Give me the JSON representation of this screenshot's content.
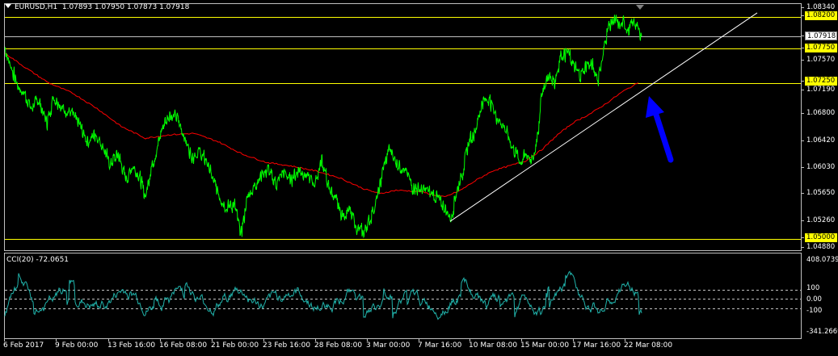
{
  "header": {
    "symbol": "EURUSD,H1",
    "ohlc": "1.07893 1.07950 1.07873 1.07918"
  },
  "indicator": {
    "label": "CCI(20) -72.0651"
  },
  "price_scale": {
    "labels": [
      {
        "text": "1.08340",
        "style": "plain"
      },
      {
        "text": "1.08200",
        "style": "highlight"
      },
      {
        "text": "1.07918",
        "style": "current"
      },
      {
        "text": "1.07750",
        "style": "highlight"
      },
      {
        "text": "1.07570",
        "style": "plain"
      },
      {
        "text": "1.07250",
        "style": "highlight"
      },
      {
        "text": "1.07190",
        "style": "plain"
      },
      {
        "text": "1.06800",
        "style": "plain"
      },
      {
        "text": "1.06420",
        "style": "plain"
      },
      {
        "text": "1.06030",
        "style": "plain"
      },
      {
        "text": "1.05650",
        "style": "plain"
      },
      {
        "text": "1.05260",
        "style": "plain"
      },
      {
        "text": "1.05000",
        "style": "highlight"
      },
      {
        "text": "1.04880",
        "style": "plain"
      }
    ]
  },
  "cci_scale": {
    "labels": [
      "408.0739",
      "100",
      "0.00",
      "-100",
      "-341.2669"
    ]
  },
  "time_scale": {
    "labels": [
      "6 Feb 2017",
      "9 Feb 00:00",
      "13 Feb 16:00",
      "16 Feb 08:00",
      "21 Feb 00:00",
      "23 Feb 16:00",
      "28 Feb 08:00",
      "3 Mar 00:00",
      "7 Mar 16:00",
      "10 Mar 08:00",
      "15 Mar 00:00",
      "17 Mar 16:00",
      "22 Mar 08:00"
    ]
  },
  "colors": {
    "background": "#000000",
    "price_line": "#00ff00",
    "moving_average": "#ff0000",
    "horizontal_levels": "#ffff00",
    "trendline": "#ffffff",
    "arrow": "#0000ff",
    "cci_line": "#20b2aa",
    "grid": "#c0c0c0"
  },
  "chart_data": {
    "type": "line",
    "symbol": "EURUSD",
    "timeframe": "H1",
    "x_type": "time",
    "ylim": [
      1.0488,
      1.0834
    ],
    "levels": [
      1.082,
      1.0775,
      1.0725,
      1.05
    ],
    "current_price": 1.07918,
    "trendline_from": [
      "7 Mar",
      1.0525
    ],
    "trendline_to": [
      "24 Mar",
      1.0826
    ],
    "series": [
      {
        "values_by_label": [
          {
            "x": "6 Feb 2017",
            "price": 1.0775
          },
          {
            "x": "9 Feb 00:00",
            "price": 1.0682
          },
          {
            "x": "13 Feb 16:00",
            "price": 1.0615
          },
          {
            "x": "16 Feb 08:00",
            "price": 1.0678
          },
          {
            "x": "21 Feb 00:00",
            "price": 1.0532
          },
          {
            "x": "23 Feb 16:00",
            "price": 1.0582
          },
          {
            "x": "28 Feb 08:00",
            "price": 1.0582
          },
          {
            "x": "3 Mar 00:00",
            "price": 1.0535
          },
          {
            "x": "7 Mar 16:00",
            "price": 1.0545
          },
          {
            "x": "10 Mar 08:00",
            "price": 1.0688
          },
          {
            "x": "15 Mar 00:00",
            "price": 1.0638
          },
          {
            "x": "17 Mar 16:00",
            "price": 1.0755
          },
          {
            "x": "22 Mar 08:00",
            "price": 1.0792
          }
        ]
      },
      {
        "values_by_label": [
          {
            "x": "6 Feb 2017",
            "price": 1.0768
          },
          {
            "x": "9 Feb 00:00",
            "price": 1.0728
          },
          {
            "x": "13 Feb 16:00",
            "price": 1.0672
          },
          {
            "x": "16 Feb 08:00",
            "price": 1.0652
          },
          {
            "x": "21 Feb 00:00",
            "price": 1.0619
          },
          {
            "x": "23 Feb 16:00",
            "price": 1.0603
          },
          {
            "x": "28 Feb 08:00",
            "price": 1.0586
          },
          {
            "x": "3 Mar 00:00",
            "price": 1.0566
          },
          {
            "x": "7 Mar 16:00",
            "price": 1.0566
          },
          {
            "x": "10 Mar 08:00",
            "price": 1.0596
          },
          {
            "x": "15 Mar 00:00",
            "price": 1.0623
          },
          {
            "x": "17 Mar 16:00",
            "price": 1.0677
          },
          {
            "x": "22 Mar 08:00",
            "price": 1.0725
          }
        ]
      }
    ]
  }
}
